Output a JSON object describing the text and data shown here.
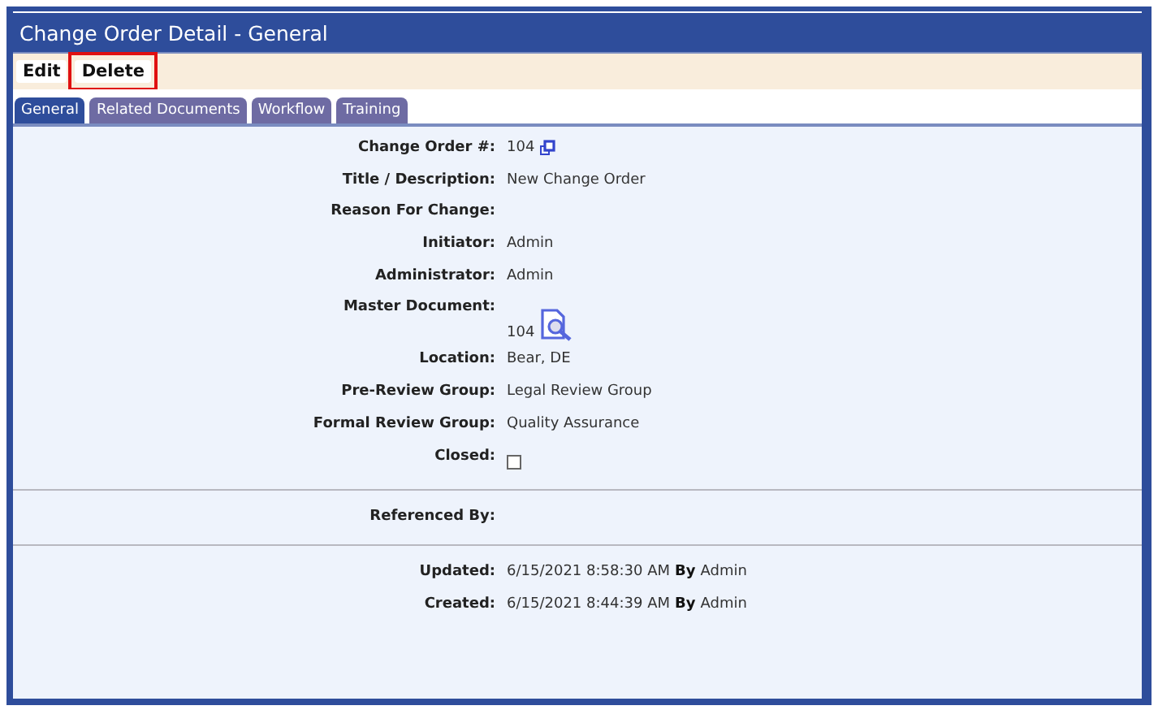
{
  "window": {
    "title": "Change Order Detail - General"
  },
  "toolbar": [
    {
      "label": "Edit",
      "highlighted": false
    },
    {
      "label": "Delete",
      "highlighted": true
    }
  ],
  "tabs": [
    {
      "label": "General",
      "selected": true
    },
    {
      "label": "Related Documents",
      "selected": false
    },
    {
      "label": "Workflow",
      "selected": false
    },
    {
      "label": "Training",
      "selected": false
    }
  ],
  "fields": [
    {
      "kind": "copy",
      "label": "Change Order #:",
      "value": "104"
    },
    {
      "kind": "text",
      "label": "Title / Description:",
      "value": "New Change Order"
    },
    {
      "kind": "text",
      "label": "Reason For Change:"
    },
    {
      "kind": "text",
      "label": "Initiator:",
      "value": "Admin"
    },
    {
      "kind": "text",
      "label": "Administrator:",
      "value": "Admin"
    },
    {
      "kind": "document",
      "label": "Master Document:",
      "value": "104"
    },
    {
      "kind": "text",
      "label": "Location:",
      "value": "Bear, DE"
    },
    {
      "kind": "text",
      "label": "Pre-Review Group:",
      "value": "Legal Review Group"
    },
    {
      "kind": "text",
      "label": "Formal Review Group:",
      "value": "Quality Assurance"
    },
    {
      "kind": "checkbox",
      "label": "Closed:",
      "checked": false
    }
  ],
  "references": {
    "label": "Referenced By:"
  },
  "audit": [
    {
      "label": "Updated:",
      "value": "6/15/2021 8:58:30 AM **By** Admin"
    },
    {
      "label": "Created:",
      "value": "6/15/2021 8:44:39 AM **By** Admin"
    }
  ]
}
